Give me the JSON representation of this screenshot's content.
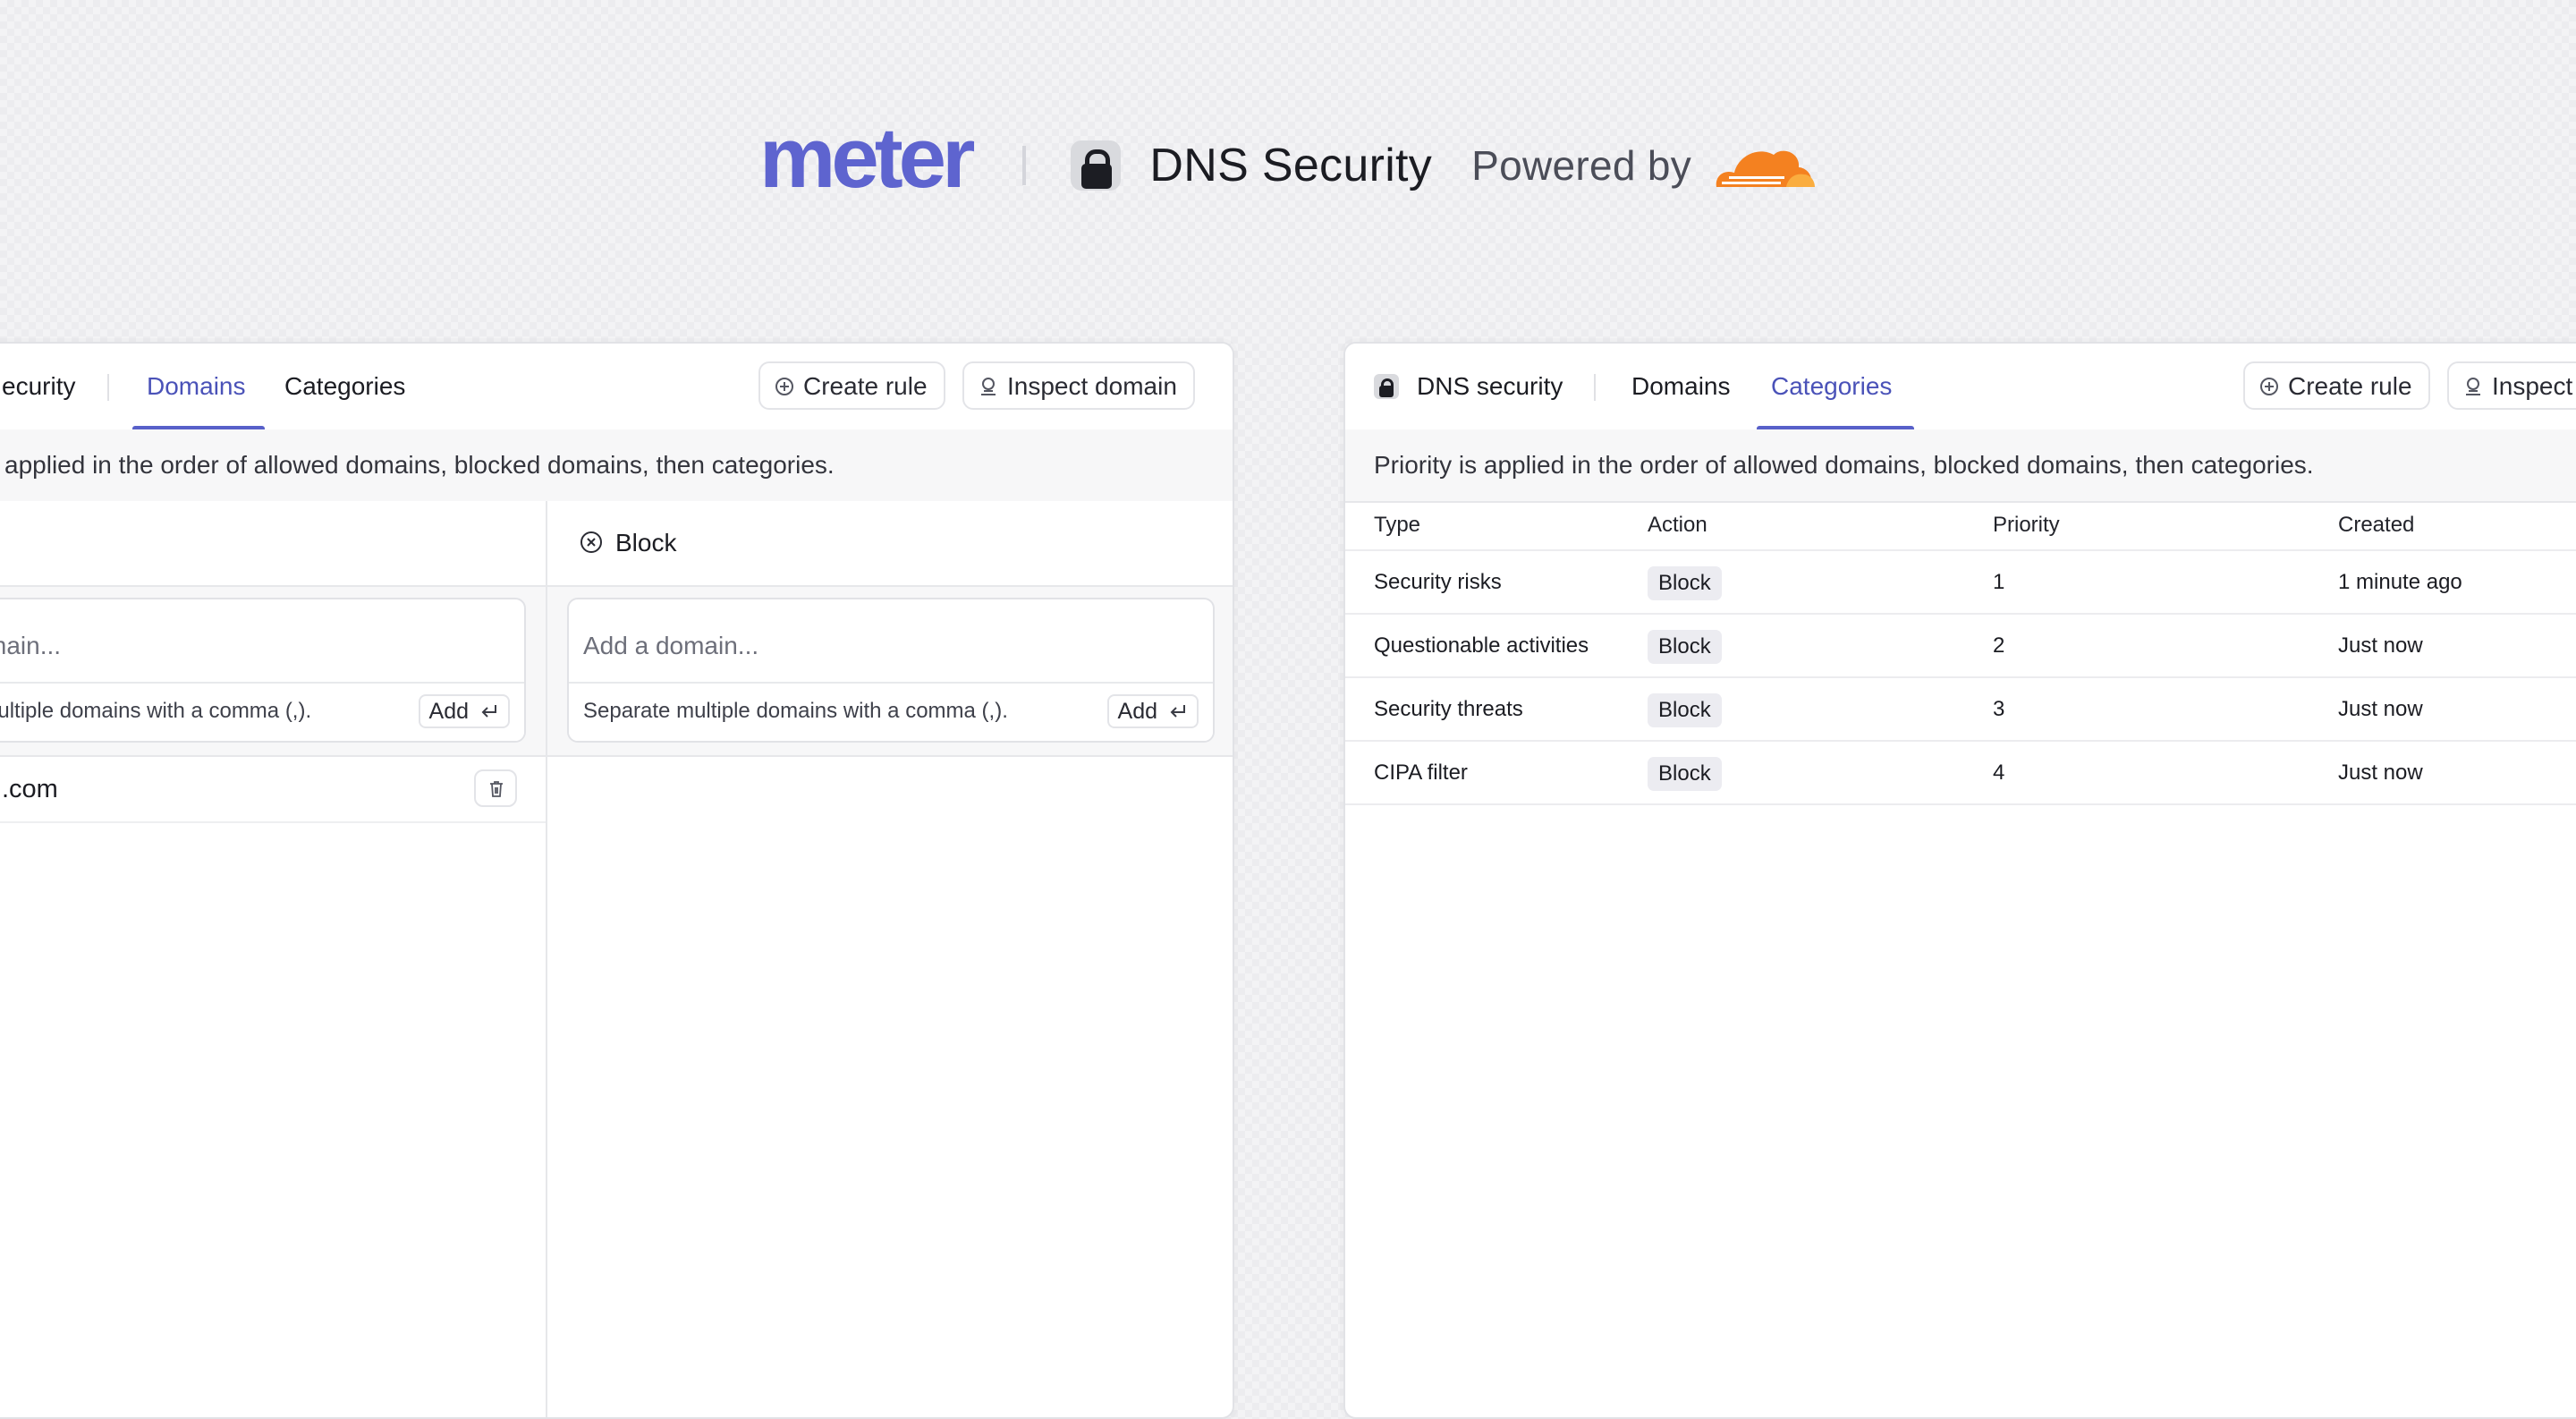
{
  "hero": {
    "brand": "meter",
    "title": "DNS Security",
    "powered_by": "Powered by",
    "partner_logo": "cloudflare-cloud-logo"
  },
  "colors": {
    "brand": "#5e64cf",
    "accent": "#5860c9",
    "cloud_orange": "#f48120",
    "cloud_light": "#faad3f"
  },
  "left_panel": {
    "tabs": {
      "section": "DNS security",
      "section_visible": "ecurity",
      "domains": "Domains",
      "categories": "Categories",
      "active": "Domains"
    },
    "toolbar": {
      "create_rule": "Create rule",
      "inspect_domain": "Inspect domain"
    },
    "notice": "Priority is applied in the order of allowed domains, blocked domains, then categories.",
    "notice_visible": "applied in the order of allowed domains, blocked domains, then categories.",
    "allow_column": {
      "placeholder_visible": "main...",
      "hint_visible": "nultiple domains with a comma (,).",
      "add_label": "Add",
      "domains": [
        ".com"
      ]
    },
    "block_column": {
      "label": "Block",
      "placeholder": "Add a domain...",
      "hint": "Separate multiple domains with a comma (,).",
      "add_label": "Add",
      "domains": []
    }
  },
  "right_panel": {
    "tabs": {
      "section": "DNS security",
      "domains": "Domains",
      "categories": "Categories",
      "active": "Categories"
    },
    "toolbar": {
      "create_rule": "Create rule",
      "inspect_visible": "Inspect"
    },
    "notice": "Priority is applied in the order of allowed domains, blocked domains, then categories.",
    "table": {
      "columns": [
        "Type",
        "Action",
        "Priority",
        "Created"
      ],
      "rows": [
        {
          "type": "Security risks",
          "action": "Block",
          "priority": "1",
          "created": "1 minute ago"
        },
        {
          "type": "Questionable activities",
          "action": "Block",
          "priority": "2",
          "created": "Just now"
        },
        {
          "type": "Security threats",
          "action": "Block",
          "priority": "3",
          "created": "Just now"
        },
        {
          "type": "CIPA filter",
          "action": "Block",
          "priority": "4",
          "created": "Just now"
        }
      ]
    }
  }
}
